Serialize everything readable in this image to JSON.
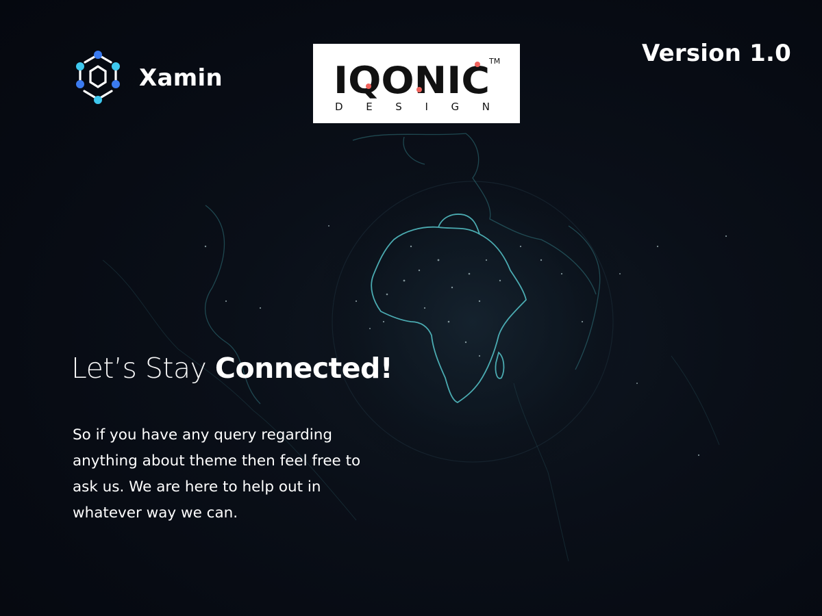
{
  "header": {
    "brand_name": "Xamin",
    "partner_logo": {
      "wordmark": "IQONIC",
      "subtitle": "DESIGN",
      "trademark": "TM"
    },
    "version": "Version 1.0"
  },
  "hero": {
    "headline_light": "Let’s Stay ",
    "headline_bold": "Connected!",
    "message": "So if you have any query regarding anything about theme then feel free to ask us. We are here to help out in whatever way we can."
  },
  "colors": {
    "background": "#070b13",
    "globe_line": "#4fc3c8",
    "logo_cyan": "#3ec8ee",
    "logo_blue": "#3b7bf0",
    "partner_dot": "#f0625c",
    "text": "#ffffff"
  },
  "icons": {
    "brand_logo": "hexagon-network-icon"
  }
}
